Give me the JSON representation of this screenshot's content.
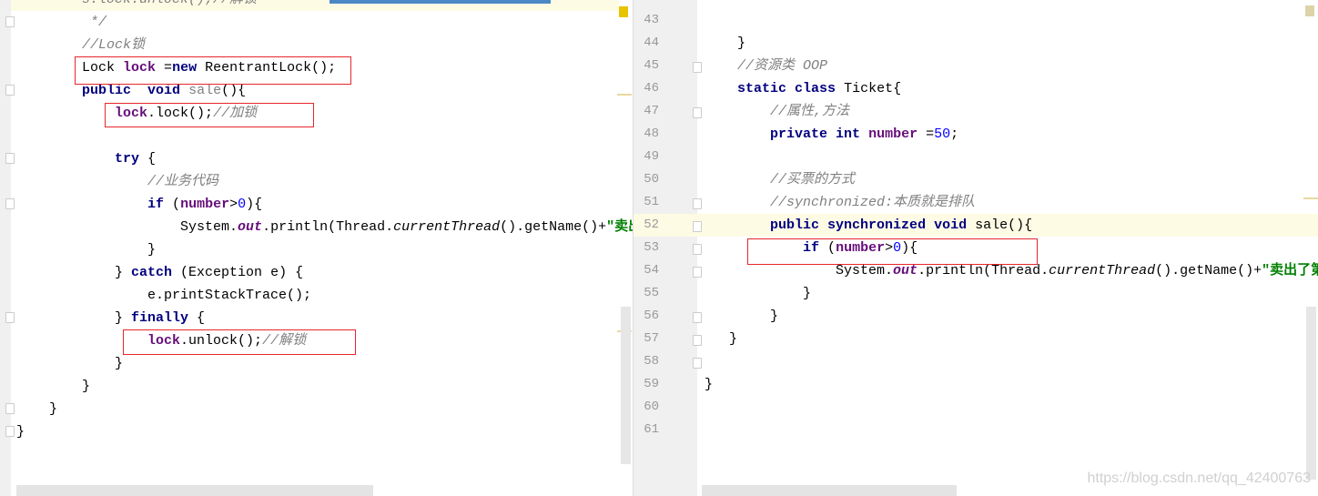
{
  "left_editor": {
    "lines": [
      [
        [
          "        s.lock.unlock();//解锁",
          "cmt"
        ]
      ],
      [
        [
          "         */",
          "cmt"
        ]
      ],
      [
        [
          "        //Lock锁",
          "cmt"
        ]
      ],
      [
        [
          "        Lock ",
          "plain"
        ],
        [
          "lock",
          "fld"
        ],
        [
          " =",
          "plain"
        ],
        [
          "new",
          "kw"
        ],
        [
          " ReentrantLock();",
          "plain"
        ]
      ],
      [
        [
          "        ",
          "plain"
        ],
        [
          "public",
          "kw"
        ],
        [
          "  ",
          "plain"
        ],
        [
          "void",
          "kw"
        ],
        [
          " ",
          "plain"
        ],
        [
          "sale",
          "unused"
        ],
        [
          "(){",
          "plain"
        ]
      ],
      [
        [
          "            ",
          "plain"
        ],
        [
          "lock",
          "fld"
        ],
        [
          ".lock();",
          "plain"
        ],
        [
          "//加锁",
          "cmt"
        ]
      ],
      [],
      [
        [
          "            ",
          "plain"
        ],
        [
          "try",
          "kw"
        ],
        [
          " {",
          "plain"
        ]
      ],
      [
        [
          "                //业务代码",
          "cmt"
        ]
      ],
      [
        [
          "                ",
          "plain"
        ],
        [
          "if",
          "kw"
        ],
        [
          " (",
          "plain"
        ],
        [
          "number",
          "fld"
        ],
        [
          ">",
          "plain"
        ],
        [
          "0",
          "num"
        ],
        [
          "){",
          "plain"
        ]
      ],
      [
        [
          "                    System.",
          "plain"
        ],
        [
          "out",
          "sfld"
        ],
        [
          ".println(Thread.",
          "plain"
        ],
        [
          "currentThread",
          "sm"
        ],
        [
          "().getName()+",
          "plain"
        ],
        [
          "\"卖出了第",
          "str"
        ]
      ],
      [
        [
          "                }",
          "plain"
        ]
      ],
      [
        [
          "            } ",
          "plain"
        ],
        [
          "catch",
          "kw"
        ],
        [
          " (Exception e) {",
          "plain"
        ]
      ],
      [
        [
          "                e.printStackTrace();",
          "plain"
        ]
      ],
      [
        [
          "            } ",
          "plain"
        ],
        [
          "finally",
          "kw"
        ],
        [
          " {",
          "plain"
        ]
      ],
      [
        [
          "                ",
          "plain"
        ],
        [
          "lock",
          "fld"
        ],
        [
          ".unlock();",
          "plain"
        ],
        [
          "//解锁",
          "cmt"
        ]
      ],
      [
        [
          "            }",
          "plain"
        ]
      ],
      [
        [
          "        }",
          "plain"
        ]
      ],
      [
        [
          "    }",
          "plain"
        ]
      ],
      [
        [
          "}",
          "plain"
        ]
      ]
    ]
  },
  "right_editor": {
    "line_numbers": [
      "43",
      "44",
      "45",
      "46",
      "47",
      "48",
      "49",
      "50",
      "51",
      "52",
      "53",
      "54",
      "55",
      "56",
      "57",
      "58",
      "59",
      "60",
      "61"
    ],
    "lines": [
      [],
      [],
      [
        [
          "    }",
          "plain"
        ]
      ],
      [
        [
          "    //资源类 OOP",
          "cmt"
        ]
      ],
      [
        [
          "    ",
          "plain"
        ],
        [
          "static",
          "kw"
        ],
        [
          " ",
          "plain"
        ],
        [
          "class",
          "kw"
        ],
        [
          " Ticket{",
          "plain"
        ]
      ],
      [
        [
          "        //属性,方法",
          "cmt"
        ]
      ],
      [
        [
          "        ",
          "plain"
        ],
        [
          "private",
          "kw"
        ],
        [
          " ",
          "plain"
        ],
        [
          "int",
          "kw"
        ],
        [
          " ",
          "plain"
        ],
        [
          "number",
          "fld"
        ],
        [
          " =",
          "plain"
        ],
        [
          "50",
          "num"
        ],
        [
          ";",
          "plain"
        ]
      ],
      [],
      [
        [
          "        //买票的方式",
          "cmt"
        ]
      ],
      [
        [
          "        //synchronized:本质就是排队",
          "cmt"
        ]
      ],
      [
        [
          "        ",
          "plain"
        ],
        [
          "public",
          "kw"
        ],
        [
          " ",
          "plain"
        ],
        [
          "synchronized",
          "kw"
        ],
        [
          " ",
          "plain"
        ],
        [
          "void",
          "kw"
        ],
        [
          " sale(){",
          "plain"
        ]
      ],
      [
        [
          "            ",
          "plain"
        ],
        [
          "if",
          "kw"
        ],
        [
          " (",
          "plain"
        ],
        [
          "number",
          "fld"
        ],
        [
          ">",
          "plain"
        ],
        [
          "0",
          "num"
        ],
        [
          "){",
          "plain"
        ]
      ],
      [
        [
          "                System.",
          "plain"
        ],
        [
          "out",
          "sfld"
        ],
        [
          ".println(Thread.",
          "plain"
        ],
        [
          "currentThread",
          "sm"
        ],
        [
          "().getName()+",
          "plain"
        ],
        [
          "\"卖出了第",
          "str"
        ]
      ],
      [
        [
          "            }",
          "plain"
        ]
      ],
      [
        [
          "        }",
          "plain"
        ]
      ],
      [
        [
          "   }",
          "plain"
        ]
      ],
      [],
      [
        [
          "}",
          "plain"
        ]
      ],
      []
    ],
    "current_line": "52"
  },
  "watermark": "https://blog.csdn.net/qq_42400763",
  "colors": {
    "highlight_box": "#e8262b",
    "keyword": "#000080",
    "field": "#660e7a",
    "string": "#008000",
    "comment": "#808080"
  }
}
